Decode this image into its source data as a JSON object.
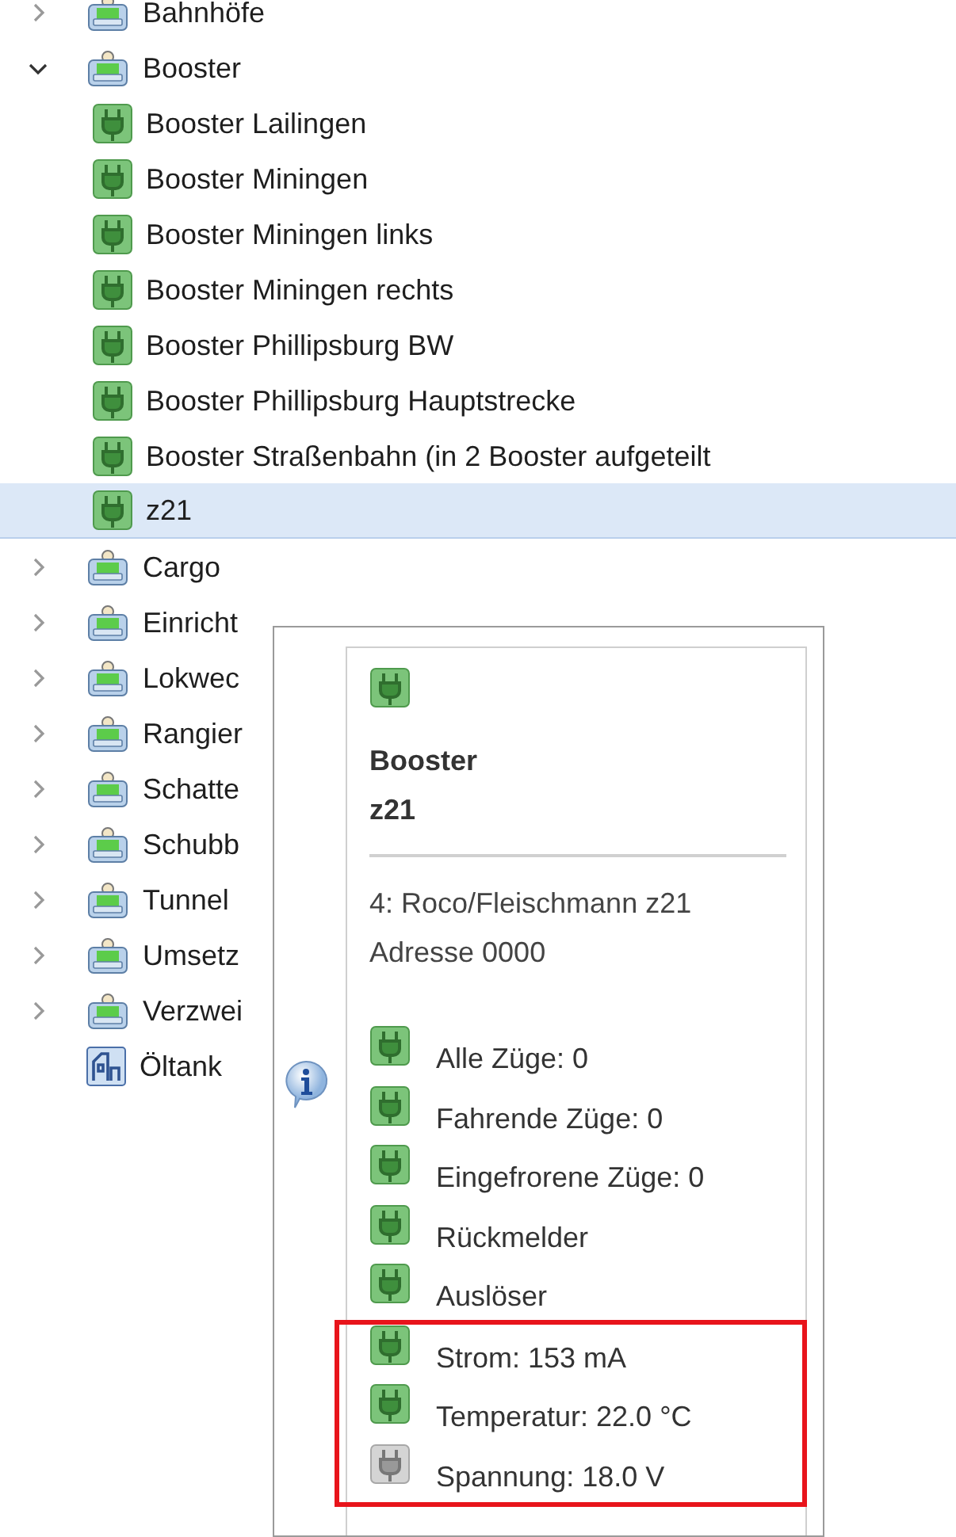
{
  "tree": [
    {
      "label": "Bahnhöfe",
      "kind": "group",
      "expanded": false,
      "selected": false
    },
    {
      "label": "Booster",
      "kind": "group",
      "expanded": true,
      "selected": false,
      "children": [
        {
          "label": "Booster Lailingen",
          "kind": "booster",
          "selected": false
        },
        {
          "label": "Booster Miningen",
          "kind": "booster",
          "selected": false
        },
        {
          "label": "Booster Miningen links",
          "kind": "booster",
          "selected": false
        },
        {
          "label": "Booster Miningen rechts",
          "kind": "booster",
          "selected": false
        },
        {
          "label": "Booster Phillipsburg BW",
          "kind": "booster",
          "selected": false
        },
        {
          "label": "Booster Phillipsburg Hauptstrecke",
          "kind": "booster",
          "selected": false
        },
        {
          "label": "Booster Straßenbahn (in 2 Booster aufgeteilt",
          "kind": "booster",
          "selected": false
        },
        {
          "label": "z21",
          "kind": "booster",
          "selected": true
        }
      ]
    },
    {
      "label": "Cargo",
      "kind": "group",
      "expanded": false,
      "selected": false
    },
    {
      "label": "Einricht",
      "kind": "group",
      "expanded": false,
      "selected": false
    },
    {
      "label": "Lokwec",
      "kind": "group",
      "expanded": false,
      "selected": false
    },
    {
      "label": "Rangier",
      "kind": "group",
      "expanded": false,
      "selected": false
    },
    {
      "label": "Schatte",
      "kind": "group",
      "expanded": false,
      "selected": false
    },
    {
      "label": "Schubb",
      "kind": "group",
      "expanded": false,
      "selected": false
    },
    {
      "label": "Tunnel",
      "kind": "group",
      "expanded": false,
      "selected": false
    },
    {
      "label": "Umsetz",
      "kind": "group",
      "expanded": false,
      "selected": false
    },
    {
      "label": "Verzwei",
      "kind": "group",
      "expanded": false,
      "selected": false
    },
    {
      "label": "Öltank",
      "kind": "tank",
      "selected": false
    }
  ],
  "tooltip": {
    "title": "Booster",
    "subtitle": "z21",
    "description": [
      "4: Roco/Fleischmann z21",
      "Adresse 0000"
    ],
    "items": [
      {
        "label": "Alle Züge: 0",
        "active": true,
        "highlighted": false
      },
      {
        "label": "Fahrende Züge: 0",
        "active": true,
        "highlighted": false
      },
      {
        "label": "Eingefrorene Züge: 0",
        "active": true,
        "highlighted": false
      },
      {
        "label": "Rückmelder",
        "active": true,
        "highlighted": false
      },
      {
        "label": "Auslöser",
        "active": true,
        "highlighted": false
      },
      {
        "label": "Strom: 153 mA",
        "active": true,
        "highlighted": true
      },
      {
        "label": "Temperatur: 22.0 °C",
        "active": true,
        "highlighted": true
      },
      {
        "label": "Spannung: 18.0 V",
        "active": false,
        "highlighted": true
      }
    ]
  }
}
